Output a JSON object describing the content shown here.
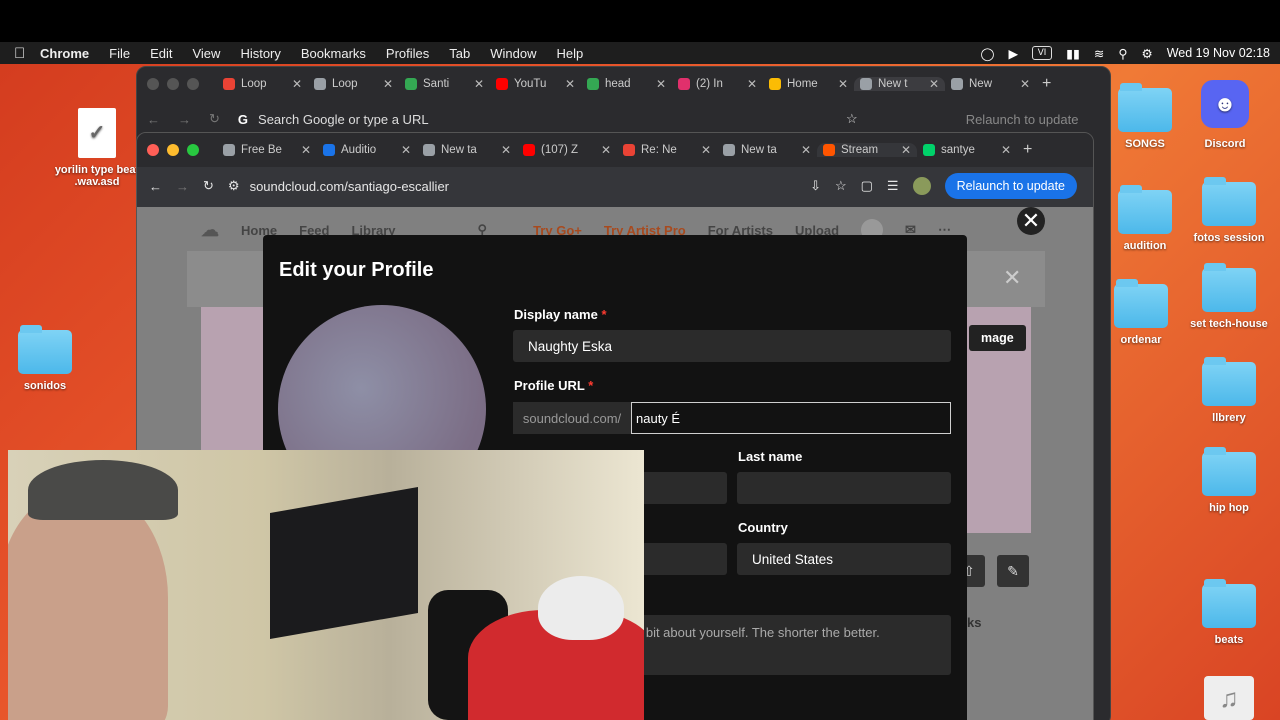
{
  "menubar": {
    "app": "Chrome",
    "items": [
      "File",
      "Edit",
      "View",
      "History",
      "Bookmarks",
      "Profiles",
      "Tab",
      "Window",
      "Help"
    ],
    "clock": "Wed 19 Nov  02:18",
    "vi": "VI"
  },
  "desktop": {
    "left": [
      {
        "label": "yorilin type beat .wav.asd"
      },
      {
        "label": "sonidos"
      }
    ],
    "right": [
      {
        "label": "SONGS"
      },
      {
        "label": "Discord"
      },
      {
        "label": "audition"
      },
      {
        "label": "fotos session"
      },
      {
        "label": "ordenar"
      },
      {
        "label": "set tech-house"
      },
      {
        "label": "llbrery"
      },
      {
        "label": "hip hop"
      },
      {
        "label": "beats"
      }
    ]
  },
  "back_window": {
    "tabs": [
      {
        "label": "Loop",
        "color": "#ea4335"
      },
      {
        "label": "Loop",
        "color": "#9aa0a6"
      },
      {
        "label": "Santi",
        "color": "#34a853"
      },
      {
        "label": "YouTu",
        "color": "#ff0000"
      },
      {
        "label": "head",
        "color": "#34a853"
      },
      {
        "label": "(2) In",
        "color": "#e1306c"
      },
      {
        "label": "Home",
        "color": "#fbbc04"
      },
      {
        "label": "New t",
        "color": "#9aa0a6"
      },
      {
        "label": "New",
        "color": "#9aa0a6"
      }
    ],
    "omnibox": "Search Google or type a URL",
    "relaunch": "Relaunch to update"
  },
  "front_window": {
    "tabs": [
      {
        "label": "Free Be",
        "color": "#9aa0a6"
      },
      {
        "label": "Auditio",
        "color": "#1a73e8"
      },
      {
        "label": "New ta",
        "color": "#9aa0a6"
      },
      {
        "label": "(107) Z",
        "color": "#ff0000"
      },
      {
        "label": "Re: Ne",
        "color": "#ea4335"
      },
      {
        "label": "New ta",
        "color": "#9aa0a6"
      },
      {
        "label": "Stream",
        "color": "#ff5500"
      },
      {
        "label": "santye",
        "color": "#00d26a"
      }
    ],
    "url": "soundcloud.com/santiago-escallier",
    "relaunch": "Relaunch to update"
  },
  "soundcloud": {
    "nav": [
      "Home",
      "Feed",
      "Library"
    ],
    "try_go": "Try Go+",
    "try_artist": "Try Artist Pro",
    "for_artists": "For Artists",
    "upload": "Upload",
    "image_btn": "mage",
    "tracks_frag": "ks"
  },
  "modal": {
    "title": "Edit your Profile",
    "display_name_label": "Display name",
    "display_name_value": "Naughty Eska",
    "profile_url_label": "Profile URL",
    "url_prefix": "soundcloud.com/",
    "url_value": "nauty É",
    "first_name_label_frag": "Fi",
    "last_name_label": "Last name",
    "country_label": "Country",
    "country_value": "United States",
    "bio_placeholder_visible": "e bit about yourself. The shorter the better.",
    "required_mark": "*"
  }
}
